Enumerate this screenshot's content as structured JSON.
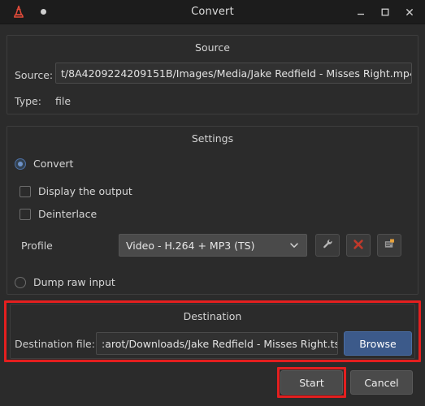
{
  "window": {
    "title": "Convert",
    "app_icon": "vlc-cone-icon",
    "record_dot": "dot-indicator",
    "controls": {
      "minimize": "minimize-icon",
      "maximize": "maximize-icon",
      "close": "close-icon"
    }
  },
  "source": {
    "group_title": "Source",
    "source_label": "Source:",
    "source_value": "t/8A4209224209151B/Images/Media/Jake Redfield - Misses Right.mp4",
    "type_label": "Type:",
    "type_value": "file"
  },
  "settings": {
    "group_title": "Settings",
    "convert_radio_label": "Convert",
    "convert_radio_checked": true,
    "display_output_label": "Display the output",
    "display_output_checked": false,
    "deinterlace_label": "Deinterlace",
    "deinterlace_checked": false,
    "profile_label": "Profile",
    "profile_value": "Video - H.264 + MP3 (TS)",
    "profile_caret": "chevron-down-icon",
    "edit_profile_icon": "wrench-icon",
    "delete_profile_icon": "delete-x-icon",
    "new_profile_icon": "new-profile-icon",
    "dump_raw_label": "Dump raw input",
    "dump_raw_checked": false
  },
  "destination": {
    "group_title": "Destination",
    "file_label": "Destination file:",
    "file_value": ":arot/Downloads/Jake Redfield - Misses Right.ts",
    "browse_label": "Browse"
  },
  "footer": {
    "start_label": "Start",
    "cancel_label": "Cancel"
  },
  "annotations": {
    "destination_highlight": "destination-section-highlight",
    "start_highlight": "start-button-highlight",
    "color": "#e41f1f"
  }
}
